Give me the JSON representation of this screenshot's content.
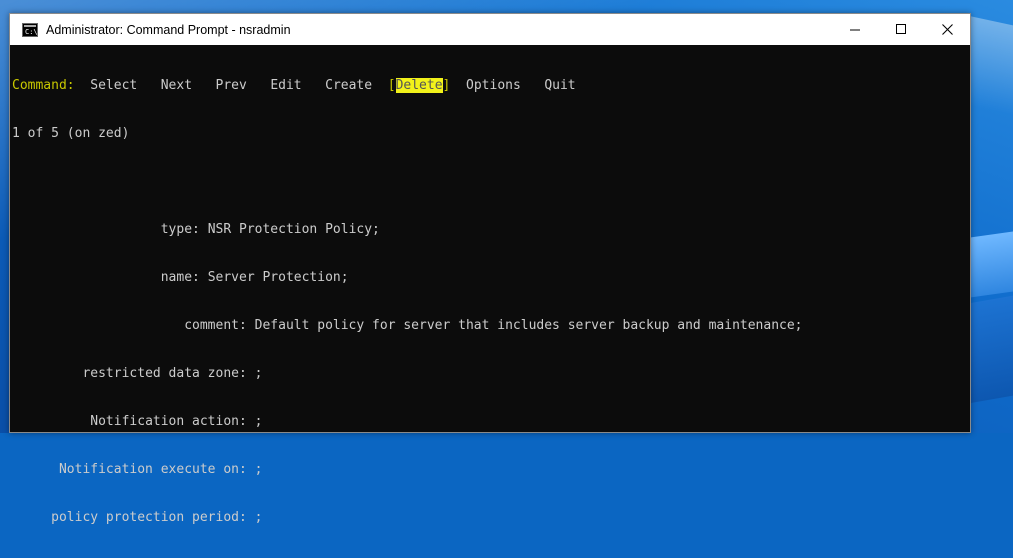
{
  "window": {
    "title": "Administrator: Command Prompt - nsradmin",
    "icon": "cmd-icon",
    "icon_text": "C:\\"
  },
  "menu": {
    "command_label": "Command:",
    "items": [
      "Select",
      "Next",
      "Prev",
      "Edit",
      "Create",
      "Delete",
      "Options",
      "Quit"
    ],
    "highlighted": "Delete"
  },
  "status": "1 of 5 (on zed)",
  "fields": [
    {
      "label": "type:",
      "value": "NSR Protection Policy;"
    },
    {
      "label": "name:",
      "value": "Server Protection;"
    },
    {
      "label": "comment:",
      "value": "Default policy for server that includes server backup and maintenance;"
    },
    {
      "label": "restricted data zone:",
      "value": ";"
    },
    {
      "label": "Notification action:",
      "value": ";"
    },
    {
      "label": "Notification execute on:",
      "value": ";"
    },
    {
      "label": "policy protection period:",
      "value": ";"
    }
  ],
  "colors": {
    "console_bg": "#0c0c0c",
    "console_text": "#cccccc",
    "command_yellow": "#c8c800",
    "highlight": "#f2f21a"
  }
}
